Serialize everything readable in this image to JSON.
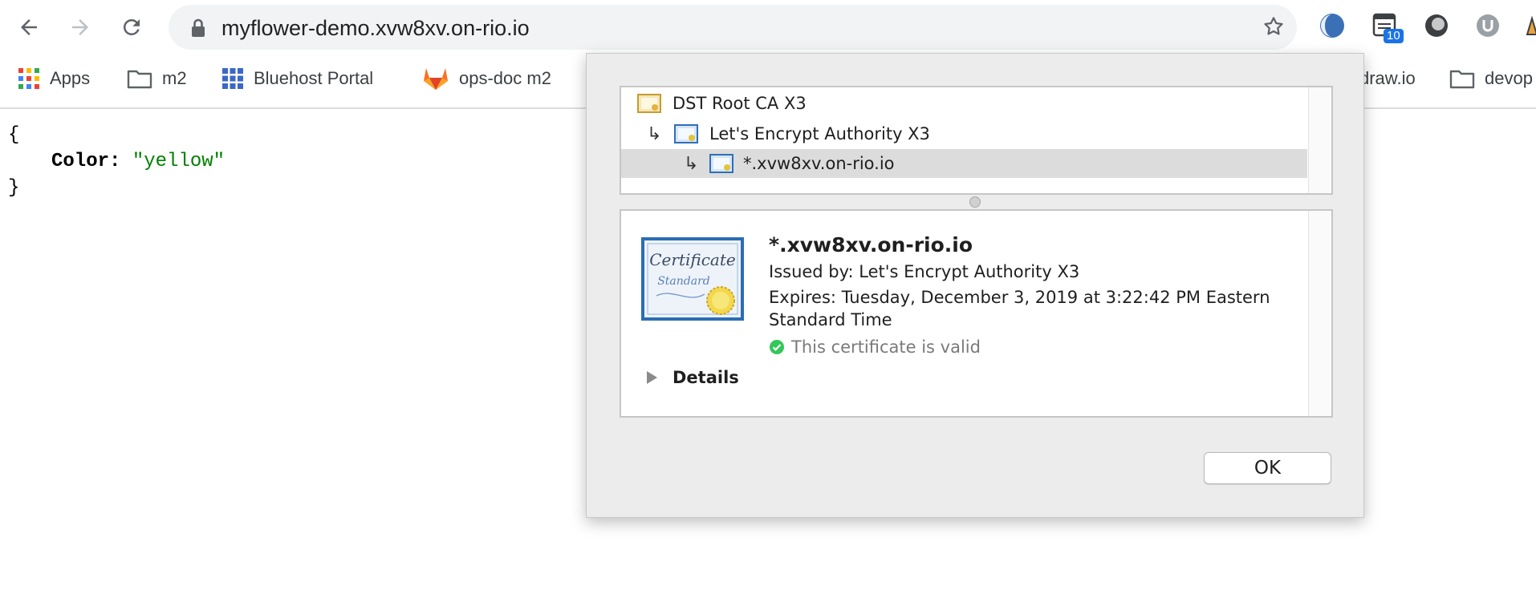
{
  "browser": {
    "url": "myflower-demo.xvw8xv.on-rio.io",
    "extension_badge": "10"
  },
  "bookmarks": [
    {
      "label": "Apps",
      "icon": "apps-grid-icon"
    },
    {
      "label": "m2",
      "icon": "folder-icon"
    },
    {
      "label": "Bluehost Portal",
      "icon": "bluehost-icon"
    },
    {
      "label": "ops-doc m2",
      "icon": "gitlab-icon"
    },
    {
      "label": "draw.io",
      "icon": "drawio-icon"
    },
    {
      "label": "devop",
      "icon": "folder-icon"
    }
  ],
  "page": {
    "open_brace": "{",
    "key": "Color:",
    "value": "\"yellow\"",
    "close_brace": "}"
  },
  "certificate_sheet": {
    "chain": [
      {
        "label": "DST Root CA X3",
        "icon": "root-certificate-icon"
      },
      {
        "label": "Let's Encrypt Authority X3",
        "icon": "intermediate-certificate-icon"
      },
      {
        "label": "*.xvw8xv.on-rio.io",
        "icon": "leaf-certificate-icon"
      }
    ],
    "selected": {
      "title": "*.xvw8xv.on-rio.io",
      "issued_by": "Issued by: Let's Encrypt Authority X3",
      "expires_line1": "Expires: Tuesday, December 3, 2019 at 3:22:42 PM Eastern",
      "expires_line2": "Standard Time",
      "status": "This certificate is valid",
      "image_text_1": "Certificate",
      "image_text_2": "Standard"
    },
    "details_label": "Details",
    "ok_label": "OK"
  },
  "colors": {
    "valid_green": "#34c759",
    "json_string": "#008000"
  }
}
